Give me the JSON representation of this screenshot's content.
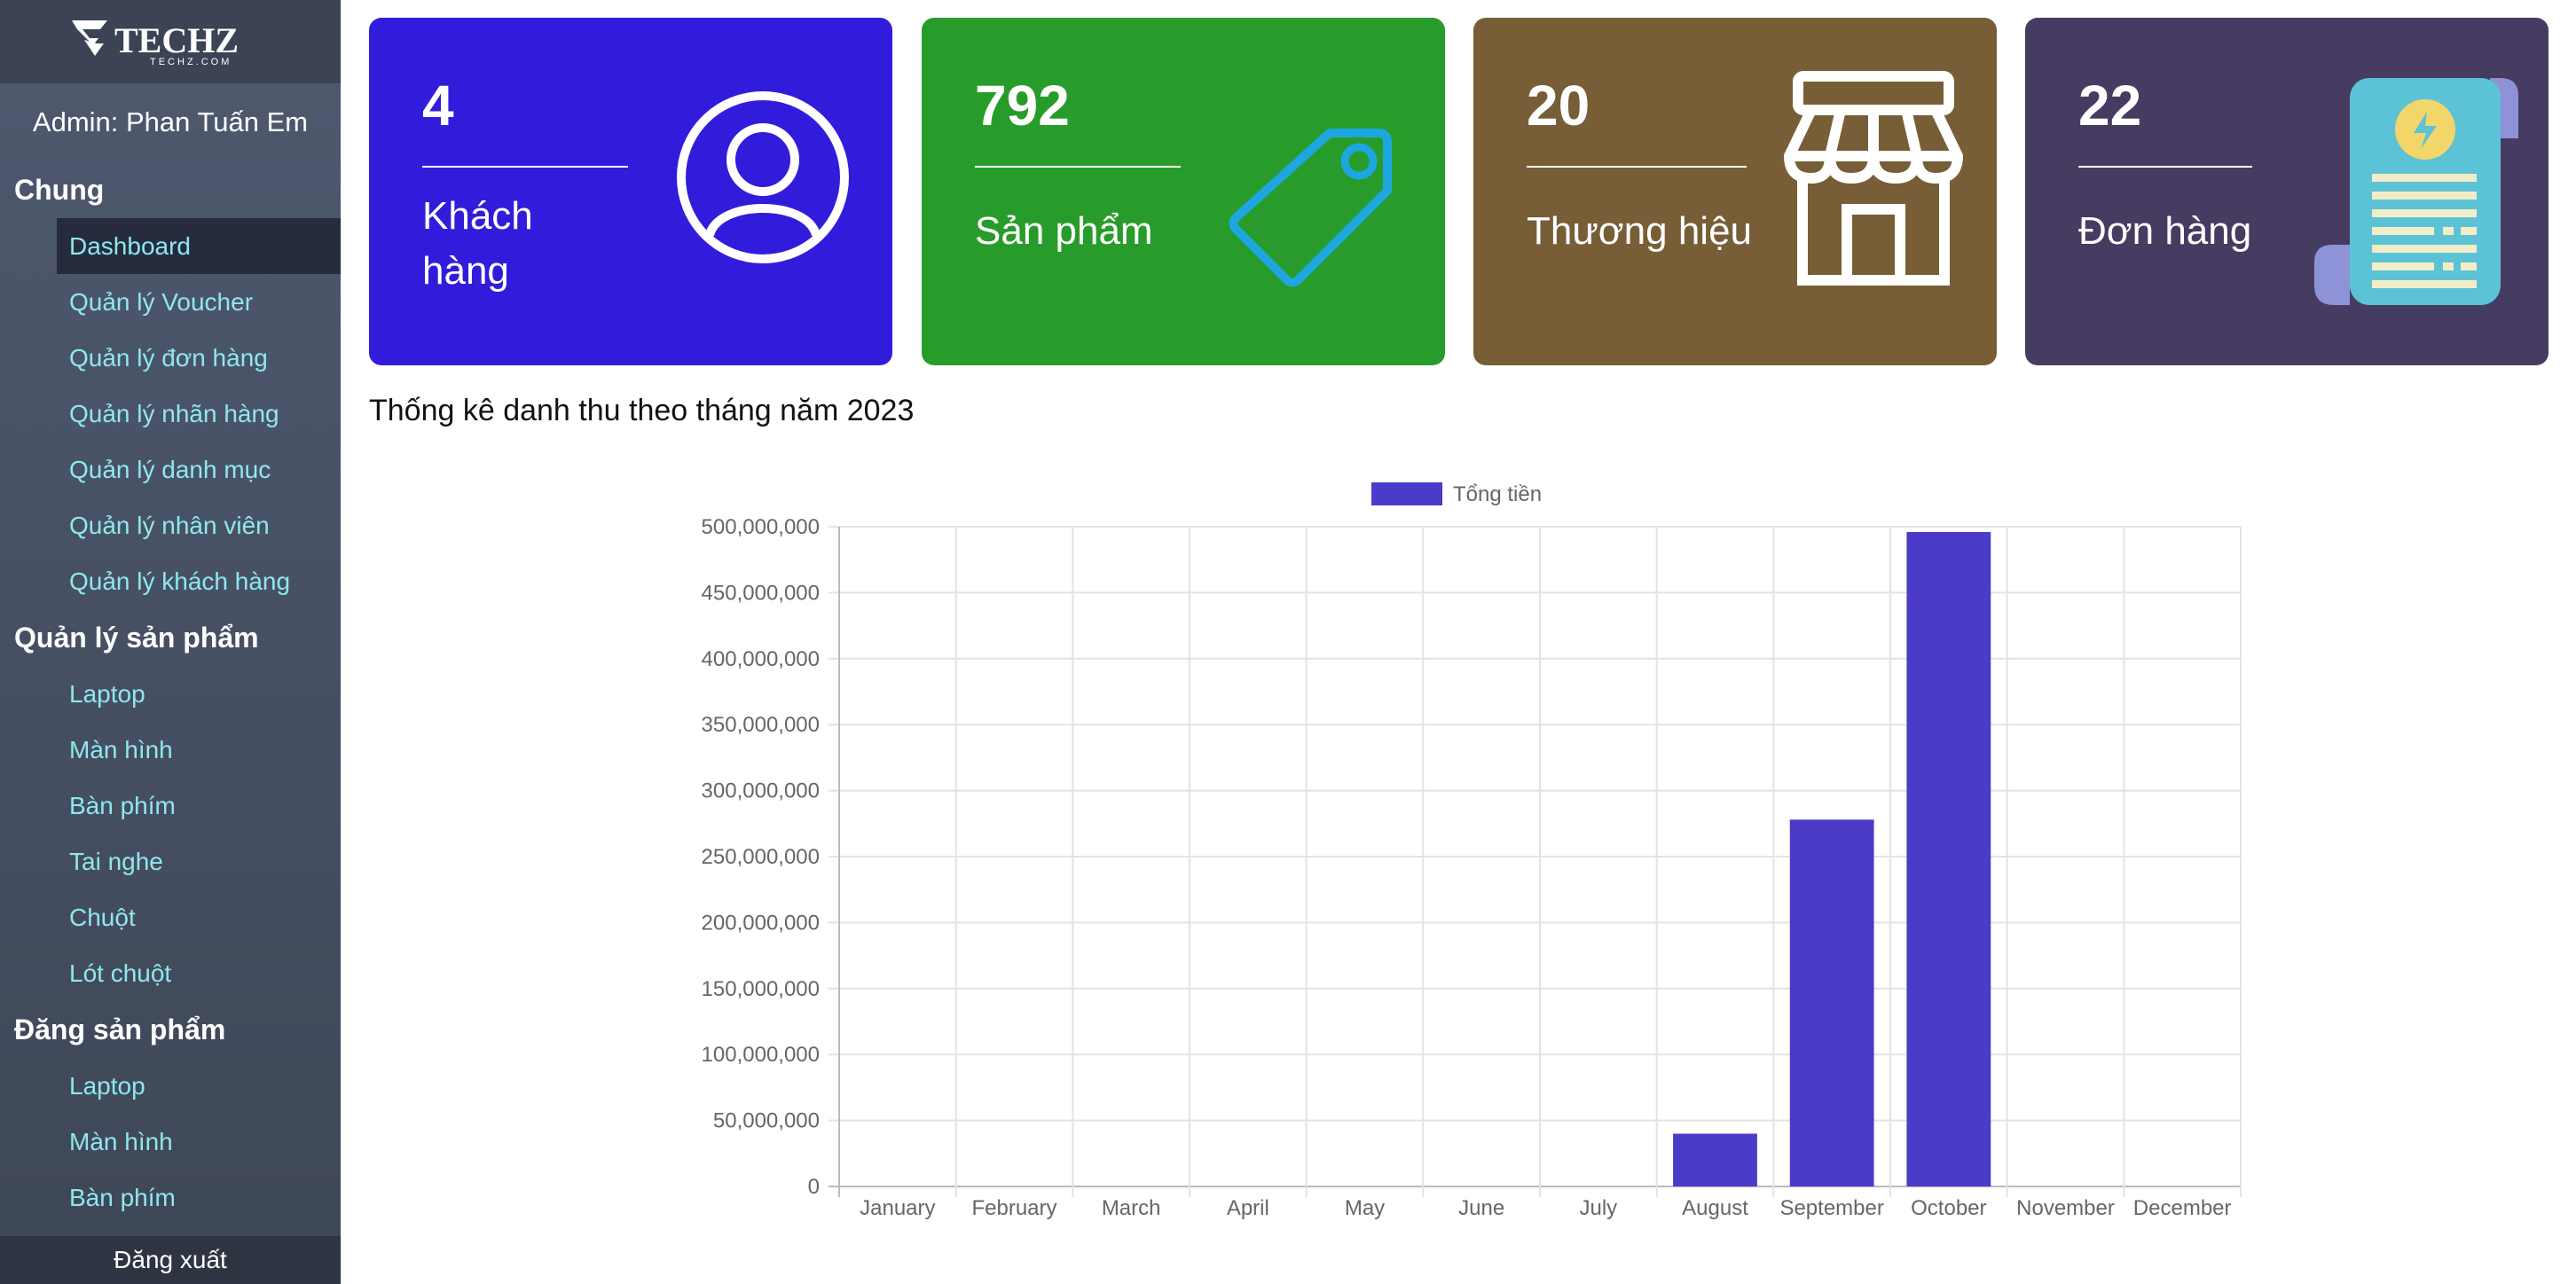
{
  "logo": {
    "brand": "TECHZ",
    "sub": "TECHZ.COM"
  },
  "sidebar": {
    "admin_label": "Admin: Phan Tuấn Em",
    "section_general": "Chung",
    "general_items": [
      "Dashboard",
      "Quản lý Voucher",
      "Quản lý đơn hàng",
      "Quản lý nhãn hàng",
      "Quản lý danh mục",
      "Quản lý nhân viên",
      "Quản lý khách hàng"
    ],
    "section_products": "Quản lý sản phẩm",
    "product_items": [
      "Laptop",
      "Màn hình",
      "Bàn phím",
      "Tai nghe",
      "Chuột",
      "Lót chuột"
    ],
    "section_post": "Đăng sản phẩm",
    "post_items": [
      "Laptop",
      "Màn hình",
      "Bàn phím"
    ],
    "logout_label": "Đăng xuất"
  },
  "cards": [
    {
      "value": "4",
      "label": "Khách hàng",
      "color": "#321cdc",
      "icon": "user-icon"
    },
    {
      "value": "792",
      "label": "Sản phẩm",
      "color": "#289c2a",
      "icon": "tag-icon"
    },
    {
      "value": "20",
      "label": "Thương hiệu",
      "color": "#775e36",
      "icon": "store-icon"
    },
    {
      "value": "22",
      "label": "Đơn hàng",
      "color": "#463b60",
      "icon": "receipt-icon"
    }
  ],
  "chart_title": "Thống kê danh thu theo tháng năm 2023",
  "colors": {
    "accent_nav": "#8fe7ee",
    "bar": "#4a3bc8"
  },
  "chart_data": {
    "type": "bar",
    "categories": [
      "January",
      "February",
      "March",
      "April",
      "May",
      "June",
      "July",
      "August",
      "September",
      "October",
      "November",
      "December"
    ],
    "series": [
      {
        "name": "Tổng tiền",
        "values": [
          0,
          0,
          0,
          0,
          0,
          0,
          0,
          40000000,
          278000000,
          496000000,
          0,
          0
        ]
      }
    ],
    "ylim": [
      0,
      500000000
    ],
    "yticks": [
      "0",
      "50,000,000",
      "100,000,000",
      "150,000,000",
      "200,000,000",
      "250,000,000",
      "300,000,000",
      "350,000,000",
      "400,000,000",
      "450,000,000",
      "500,000,000"
    ],
    "grid": true,
    "legend": "top-center"
  }
}
